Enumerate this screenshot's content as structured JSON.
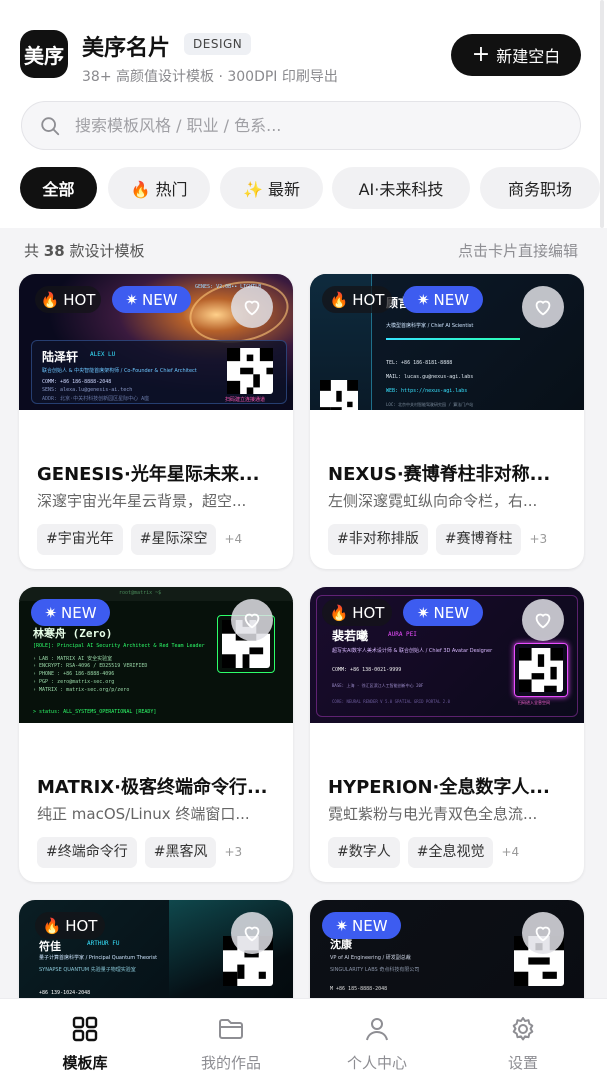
{
  "header": {
    "logo_text": "美序",
    "app_title": "美序名片",
    "design_badge": "DESIGN",
    "subtitle": "38+ 高颜值设计模板 · 300DPI 印刷导出",
    "new_button": "新建空白"
  },
  "search": {
    "placeholder": "搜索模板风格 / 职业 / 色系..."
  },
  "filters": [
    {
      "label": "全部",
      "active": true
    },
    {
      "label": "🔥 热门",
      "active": false
    },
    {
      "label": "✨ 最新",
      "active": false
    },
    {
      "label": "AI·未来科技",
      "active": false
    },
    {
      "label": "商务职场",
      "active": false
    }
  ],
  "summary": {
    "count_prefix": "共",
    "count": "38",
    "count_suffix": "款设计模板",
    "hint": "点击卡片直接编辑"
  },
  "badges": {
    "hot": "HOT",
    "new": "NEW"
  },
  "cards": [
    {
      "title": "GENESIS·光年星际未来...",
      "desc": "深邃宇宙光年星云背景，超空...",
      "tags": [
        "#宇宙光年",
        "#星际深空"
      ],
      "more": "+4",
      "thumb": {
        "name": "陆泽轩",
        "en_name": "ALEX LU",
        "role": "联合创始人 & 中央智能首席架构师 / Co-Founder & Chief Architect",
        "comm": "COMM: +86 186-8888-2048",
        "mail": "SENS: alexa.lu@genesis-ai.tech",
        "addr": "ADDR: 北京·中关村科技创新园区星际中心 A座",
        "header_text": "GENES: V2.0B∙∙ LIGHTLB",
        "qr_caption": "扫码建立连接通道"
      }
    },
    {
      "title": "NEXUS·赛博脊柱非对称...",
      "desc": "左侧深邃霓虹纵向命令栏，右...",
      "tags": [
        "#非对称排版",
        "#赛博脊柱"
      ],
      "more": "+3",
      "thumb": {
        "name": "顾言辰",
        "role": "大模型首席科学家 / Chief AI Scientist",
        "tel": "TEL: +86 186-8181-8888",
        "mail": "MAIL: lucas.gu@nexus-agi.labs",
        "web": "WEB: https://nexus-agi.labs",
        "loc": "LOC: 北京中关村智能驾驶研究园 / 算法门户站"
      }
    },
    {
      "title": "MATRIX·极客终端命令行...",
      "desc": "纯正 macOS/Linux 终端窗口...",
      "tags": [
        "#终端命令行",
        "#黑客风"
      ],
      "more": "+3",
      "thumb": {
        "terminal_title": "root@matrix ~$",
        "name": "林寒舟 (Zero)",
        "role": "[ROLE]: Principal AI Security Architect & Red Team Leader",
        "lines": [
          "› LAB   : MATRIX AI 安全实验室",
          "› ENCRYPT: RSA-4096 / ED25519 VERIFIED",
          "› PHONE : +86 186-8888-4096",
          "› PGP   : zero@matrix-sec.org",
          "› MATRIX : matrix-sec.org/p/zero"
        ],
        "status": "> status: ALL_SYSTEMS_OPERATIONAL [READY]"
      }
    },
    {
      "title": "HYPERION·全息数字人...",
      "desc": "霓虹紫粉与电光青双色全息流...",
      "tags": [
        "#数字人",
        "#全息视觉"
      ],
      "more": "+4",
      "thumb": {
        "name": "裴若曦",
        "en_name": "AURA PEI",
        "role": "超写实AI数字人美术设计师 & 联合创始人 / Chief 3D Avatar Designer",
        "comm": "COMM: +86 138-0021-9999",
        "addr": "BASE: 上海 · 徐汇区滨江人工智能创新中心 20F",
        "footer": "CORE: NEURAL RENDER  V 5.0    SPATIAL GRID  PORTAL 2.0",
        "qr_caption": "扫码进入全息空间"
      }
    },
    {
      "title": "",
      "desc": "",
      "tags": [],
      "more": "",
      "thumb": {
        "name": "符佳",
        "en_name": "ARTHUR FU",
        "role": "量子计算首席科学家 / Principal Quantum Theorist",
        "lab": "SYNAPSE QUANTUM 先验量子物理实验室",
        "phone": "+86 139-1024-2048"
      }
    },
    {
      "title": "",
      "desc": "",
      "tags": [],
      "more": "",
      "thumb": {
        "name": "沈康",
        "role": "VP of AI Engineering / 研发副总裁",
        "company": "SINGULARITY LABS 奇点科技有限公司",
        "phone": "M +86 185-8888-2048"
      }
    }
  ],
  "nav": [
    {
      "label": "模板库",
      "icon": "grid-icon",
      "active": true
    },
    {
      "label": "我的作品",
      "icon": "folder-icon",
      "active": false
    },
    {
      "label": "个人中心",
      "icon": "user-icon",
      "active": false
    },
    {
      "label": "设置",
      "icon": "gear-icon",
      "active": false
    }
  ],
  "colors": {
    "accent": "#3d5cf0",
    "primary": "#111111",
    "neon_green": "#2dff6a",
    "neon_cyan": "#37e3ff",
    "neon_pink": "#e84dff"
  }
}
